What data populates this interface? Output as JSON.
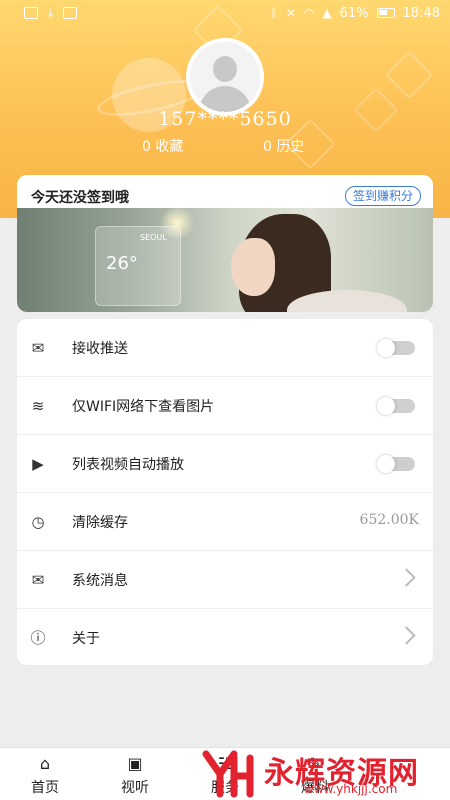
{
  "status_bar": {
    "battery": "61%",
    "time": "18:48"
  },
  "profile": {
    "phone": "157****5650",
    "favorites": "0 收藏",
    "history": "0 历史"
  },
  "sign_in": {
    "title": "今天还没签到哦",
    "button": "签到赚积分",
    "banner": {
      "city": "SEOUL",
      "temperature": "26°"
    }
  },
  "settings": {
    "items": [
      {
        "label": "接收推送",
        "icon": "envelope-push-icon",
        "control": "toggle",
        "on": false
      },
      {
        "label": "仅WIFI网络下查看图片",
        "icon": "wifi-icon",
        "control": "toggle",
        "on": false
      },
      {
        "label": "列表视频自动播放",
        "icon": "video-play-icon",
        "control": "toggle",
        "on": false
      },
      {
        "label": "清除缓存",
        "icon": "clock-clean-icon",
        "control": "value",
        "value": "652.00K"
      },
      {
        "label": "系统消息",
        "icon": "mail-icon",
        "control": "chevron"
      },
      {
        "label": "关于",
        "icon": "info-icon",
        "control": "chevron"
      }
    ]
  },
  "tabbar": {
    "tabs": [
      {
        "label": "首页",
        "icon": "home-icon"
      },
      {
        "label": "视听",
        "icon": "tv-icon"
      },
      {
        "label": "服务",
        "icon": "service-icon"
      },
      {
        "label": "爆料",
        "icon": "report-icon"
      }
    ]
  },
  "watermark": {
    "text": "永辉资源网",
    "url": "www.yhkjjj.com"
  },
  "colors": {
    "header_top": "#ffd870",
    "header_bottom": "#f8b445",
    "accent_blue": "#3a7bd5",
    "watermark_red": "#e3222f"
  }
}
